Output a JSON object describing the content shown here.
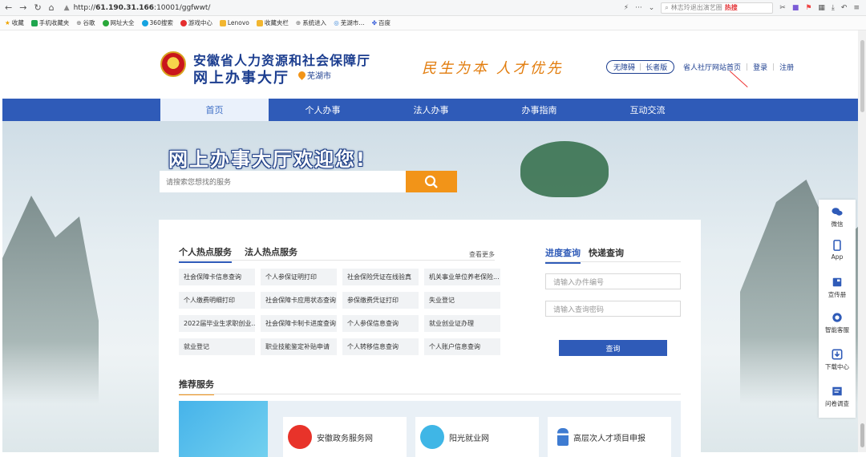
{
  "browser": {
    "url_prefix": "http://",
    "url_host": "61.190.31.166",
    "url_path": ":10001/ggfwwt/",
    "search_placeholder": "林志玲退出演艺圈",
    "hot_label": "热搜"
  },
  "bookmarks": [
    "收藏",
    "手机收藏夹",
    "谷歌",
    "网址大全",
    "360搜索",
    "游戏中心",
    "Lenovo",
    "收藏夹栏",
    "系统进入",
    "芜湖市…",
    "百度"
  ],
  "header": {
    "org_name": "安徽省人力资源和社会保障厅",
    "hall_name": "网上办事大厅",
    "city": "芜湖市",
    "slogan": "民生为本 人才优先",
    "access_barrier_free": "无障碍",
    "access_elder": "长者版",
    "portal_link": "省人社厅网站首页",
    "login": "登录",
    "register": "注册"
  },
  "nav": [
    "首页",
    "个人办事",
    "法人办事",
    "办事指南",
    "互动交流"
  ],
  "banner": {
    "welcome": "网上办事大厅欢迎您!",
    "search_placeholder": "请搜索您想找的服务"
  },
  "hot_services": {
    "tab_personal": "个人热点服务",
    "tab_legal": "法人热点服务",
    "more": "查看更多",
    "items": [
      "社会保障卡信息查询",
      "个人参保证明打印",
      "社会保险凭证在线验真",
      "机关事业单位养老保险...",
      "个人缴费明细打印",
      "社会保障卡应用状态查询",
      "参保缴费凭证打印",
      "失业登记",
      "2022届毕业生求职创业...",
      "社会保障卡制卡进度查询",
      "个人参保信息查询",
      "就业创业证办理",
      "就业登记",
      "职业技能鉴定补贴申请",
      "个人转移信息查询",
      "个人账户信息查询"
    ]
  },
  "query": {
    "tab_progress": "进度查询",
    "tab_express": "快递查询",
    "case_no_placeholder": "请输入办件编号",
    "password_placeholder": "请输入查询密码",
    "button": "查询"
  },
  "recommend": {
    "title": "推荐服务",
    "cards": [
      "安徽政务服务网",
      "阳光就业网",
      "高层次人才项目申报"
    ]
  },
  "side_toolbar": [
    "微信",
    "App",
    "宣传册",
    "智能客服",
    "下载中心",
    "问卷调查"
  ],
  "colors": {
    "brand_blue": "#2f5bb8",
    "accent_orange": "#f29418",
    "title_blue": "#1b3d8f"
  }
}
